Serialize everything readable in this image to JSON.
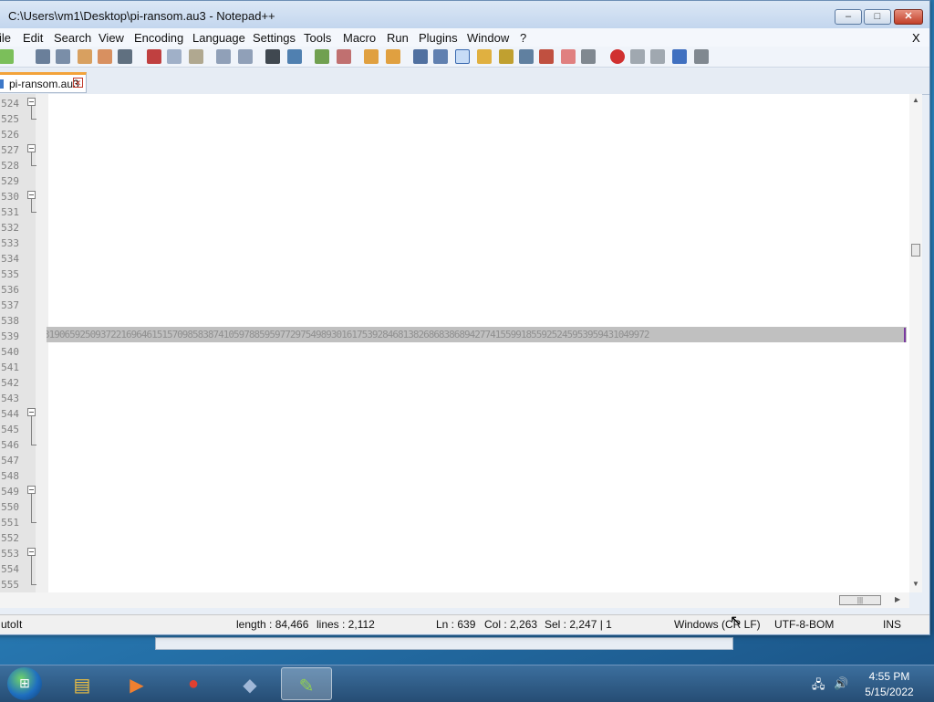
{
  "window": {
    "title": "C:\\Users\\vm1\\Desktop\\pi-ransom.au3 - Notepad++",
    "controls": {
      "minimize": "–",
      "maximize": "□",
      "close": "✕"
    }
  },
  "menubar": {
    "items": [
      "ile",
      "Edit",
      "Search",
      "View",
      "Encoding",
      "Language",
      "Settings",
      "Tools",
      "Macro",
      "Run",
      "Plugins",
      "Window",
      "?"
    ],
    "close_doc": "X"
  },
  "toolbar": {
    "icons": [
      "new-file",
      "open-file",
      "save",
      "save-all",
      "close",
      "close-all",
      "print",
      "cut",
      "copy",
      "paste",
      "undo",
      "redo",
      "find",
      "replace",
      "zoom-in",
      "zoom-out",
      "sync-v",
      "sync-h",
      "word-wrap",
      "show-all-chars",
      "indent-guide",
      "udl",
      "doc-map",
      "function-list",
      "folder-workspace",
      "monitoring",
      "record-macro",
      "stop-record",
      "play-macro",
      "run-macro-multiple",
      "save-macro"
    ],
    "accent": "#3a6ab0"
  },
  "tab": {
    "label": "pi-ransom.au3"
  },
  "editor": {
    "line_numbers": [
      "524",
      "525",
      "526",
      "527",
      "528",
      "529",
      "530",
      "531",
      "532",
      "533",
      "534",
      "535",
      "536",
      "537",
      "538",
      "539",
      "540",
      "541",
      "542",
      "543",
      "544",
      "545",
      "546",
      "547",
      "548",
      "549",
      "550",
      "551",
      "552",
      "553",
      "554",
      "555"
    ],
    "visible_line_digits": [
      "524",
      "525",
      "526",
      "527",
      "528",
      "529",
      "530",
      "531",
      "532",
      "533",
      "534",
      "535",
      "536",
      "537",
      "538",
      "539",
      "540",
      "541",
      "542",
      "543",
      "544",
      "545",
      "546",
      "547",
      "548",
      "549",
      "550",
      "551",
      "552",
      "553",
      "554",
      "555"
    ],
    "selected_line_text": "3190659250937221696461515709858387410597885959772975498930161753928468138268683868942774155991855925245953959431049972",
    "selection_color": "#c0c0c0"
  },
  "statusbar": {
    "language": "utoIt",
    "length": "length : 84,466",
    "lines": "lines : 2,112",
    "ln": "Ln : 639",
    "col": "Col : 2,263",
    "sel": "Sel : 2,247 | 1",
    "eol": "Windows (CR LF)",
    "encoding": "UTF-8-BOM",
    "mode": "INS"
  },
  "taskbar": {
    "time": "4:55 PM",
    "date": "5/15/2022",
    "apps": [
      "explorer-icon",
      "media-player-icon",
      "chrome-icon",
      "autoit-icon",
      "notepadpp-icon"
    ]
  }
}
